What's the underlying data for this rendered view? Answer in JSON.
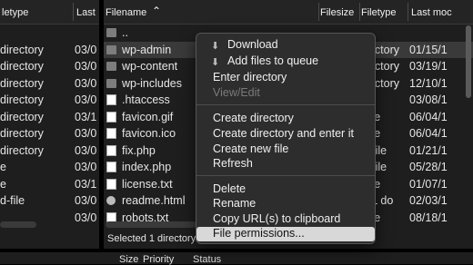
{
  "left_pane": {
    "headers": [
      "letype",
      "Last"
    ],
    "rows": [
      {
        "type": "",
        "date": ""
      },
      {
        "type": "directory",
        "date": "03/0"
      },
      {
        "type": "directory",
        "date": "03/0"
      },
      {
        "type": "directory",
        "date": "03/0"
      },
      {
        "type": "directory",
        "date": "03/0"
      },
      {
        "type": "directory",
        "date": "03/1"
      },
      {
        "type": "directory",
        "date": "03/0"
      },
      {
        "type": "directory",
        "date": "03/0"
      },
      {
        "type": "e",
        "date": "03/0"
      },
      {
        "type": "e",
        "date": "03/1"
      },
      {
        "type": "d-file",
        "date": "03/0"
      },
      {
        "type": "",
        "date": "03/0"
      }
    ]
  },
  "right_pane": {
    "headers": {
      "filename": "Filename",
      "sort_icon": "caret-up-icon",
      "filesize": "Filesize",
      "filetype": "Filetype",
      "last_modified": "Last moc"
    },
    "rows": [
      {
        "name": "..",
        "icon": "folder",
        "type": "",
        "date": ""
      },
      {
        "name": "wp-admin",
        "icon": "folder",
        "type": "irectory",
        "date": "01/15/1",
        "selected": true
      },
      {
        "name": "wp-content",
        "icon": "folder",
        "type": "irectory",
        "date": "03/19/1"
      },
      {
        "name": "wp-includes",
        "icon": "folder",
        "type": "irectory",
        "date": "12/10/1"
      },
      {
        "name": ".htaccess",
        "icon": "file",
        "type": "e",
        "date": "03/08/1"
      },
      {
        "name": "favicon.gif",
        "icon": "file",
        "type": "-file",
        "date": "06/04/1"
      },
      {
        "name": "favicon.ico",
        "icon": "file",
        "type": "-file",
        "date": "06/04/1"
      },
      {
        "name": "fix.php",
        "icon": "file",
        "type": "p-file",
        "date": "01/21/1"
      },
      {
        "name": "index.php",
        "icon": "file",
        "type": "p-file",
        "date": "05/28/1"
      },
      {
        "name": "license.txt",
        "icon": "file",
        "type": "-file",
        "date": "01/07/1"
      },
      {
        "name": "readme.html",
        "icon": "globe",
        "type": "ML do",
        "date": "02/03/1"
      },
      {
        "name": "robots.txt",
        "icon": "file",
        "type": "-file",
        "date": "08/18/1"
      }
    ],
    "status": "Selected 1 directory"
  },
  "queue": {
    "headers": [
      "Size",
      "Priority",
      "Status"
    ]
  },
  "context_menu": {
    "items": [
      {
        "label": "Download",
        "icon": "download-icon"
      },
      {
        "label": "Add files to queue",
        "icon": "add-to-queue-icon"
      },
      {
        "label": "Enter directory"
      },
      {
        "label": "View/Edit",
        "disabled": true
      },
      {
        "label": "Create directory"
      },
      {
        "label": "Create directory and enter it"
      },
      {
        "label": "Create new file"
      },
      {
        "label": "Refresh"
      },
      {
        "label": "Delete"
      },
      {
        "label": "Rename"
      },
      {
        "label": "Copy URL(s) to clipboard"
      },
      {
        "label": "File permissions...",
        "highlighted": true
      }
    ]
  }
}
